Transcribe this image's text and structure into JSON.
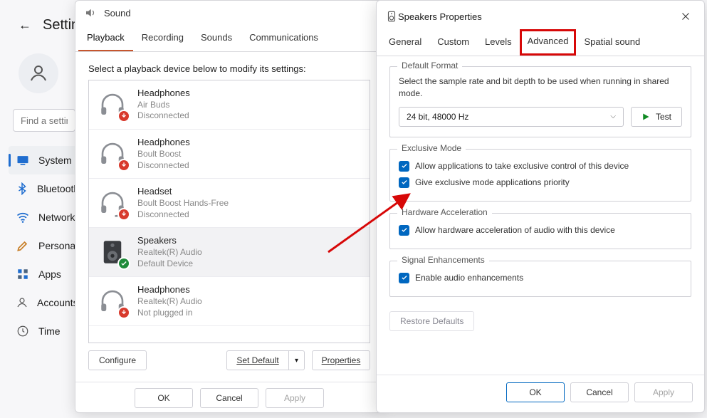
{
  "settings": {
    "title": "Settings",
    "search_placeholder": "Find a setting",
    "nav": [
      {
        "label": "System",
        "icon": "system"
      },
      {
        "label": "Bluetooth",
        "icon": "bluetooth"
      },
      {
        "label": "Network",
        "icon": "wifi"
      },
      {
        "label": "Personalization",
        "icon": "brush"
      },
      {
        "label": "Apps",
        "icon": "apps"
      },
      {
        "label": "Accounts",
        "icon": "account"
      },
      {
        "label": "Time",
        "icon": "clock"
      }
    ]
  },
  "sound_dialog": {
    "title": "Sound",
    "tabs": [
      "Playback",
      "Recording",
      "Sounds",
      "Communications"
    ],
    "active_tab": 0,
    "intro": "Select a playback device below to modify its settings:",
    "devices": [
      {
        "name": "Headphones",
        "sub": "Air Buds",
        "status": "Disconnected",
        "icon": "headphones",
        "badge": "down"
      },
      {
        "name": "Headphones",
        "sub": "Boult Boost",
        "status": "Disconnected",
        "icon": "headphones",
        "badge": "down"
      },
      {
        "name": "Headset",
        "sub": "Boult Boost Hands-Free",
        "status": "Disconnected",
        "icon": "headset",
        "badge": "down"
      },
      {
        "name": "Speakers",
        "sub": "Realtek(R) Audio",
        "status": "Default Device",
        "icon": "speaker",
        "badge": "check",
        "selected": true
      },
      {
        "name": "Headphones",
        "sub": "Realtek(R) Audio",
        "status": "Not plugged in",
        "icon": "headphones",
        "badge": "down"
      }
    ],
    "configure_btn": "Configure",
    "set_default_btn": "Set Default",
    "properties_btn": "Properties",
    "ok_btn": "OK",
    "cancel_btn": "Cancel",
    "apply_btn": "Apply"
  },
  "props_dialog": {
    "title": "Speakers Properties",
    "tabs": [
      "General",
      "Custom",
      "Levels",
      "Advanced",
      "Spatial sound"
    ],
    "highlighted_tab": 3,
    "groups": {
      "default_format": {
        "legend": "Default Format",
        "desc": "Select the sample rate and bit depth to be used when running in shared mode.",
        "combo_value": "24 bit, 48000 Hz",
        "test_btn": "Test"
      },
      "exclusive": {
        "legend": "Exclusive Mode",
        "checks": [
          "Allow applications to take exclusive control of this device",
          "Give exclusive mode applications priority"
        ]
      },
      "hwaccel": {
        "legend": "Hardware Acceleration",
        "checks": [
          "Allow hardware acceleration of audio with this device"
        ]
      },
      "enhance": {
        "legend": "Signal Enhancements",
        "checks": [
          "Enable audio enhancements"
        ]
      }
    },
    "restore_btn": "Restore Defaults",
    "ok_btn": "OK",
    "cancel_btn": "Cancel",
    "apply_btn": "Apply"
  }
}
